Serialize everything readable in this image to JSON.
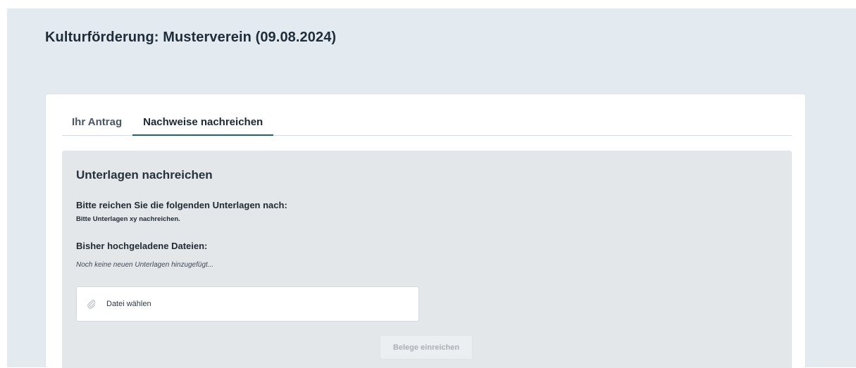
{
  "page": {
    "title": "Kulturförderung: Musterverein (09.08.2024)"
  },
  "tabs": [
    {
      "label": "Ihr Antrag",
      "active": false
    },
    {
      "label": "Nachweise nachreichen",
      "active": true
    }
  ],
  "panel": {
    "title": "Unterlagen nachreichen",
    "requested_heading": "Bitte reichen Sie die folgenden Unterlagen nach:",
    "requested_detail": "Bitte Unterlagen xy nachreichen.",
    "uploaded_heading": "Bisher hochgeladene Dateien:",
    "uploaded_empty": "Noch keine neuen Unterlagen hinzugefügt...",
    "file_picker": {
      "icon": "paperclip-icon",
      "label": "Datei wählen"
    },
    "submit_label": "Belege einreichen",
    "submit_disabled": true
  },
  "colors": {
    "background": "#e3eaf0",
    "panel": "#e4e7ea",
    "active_tab_underline": "#1f5f6e",
    "disabled_text": "#a8b0b7"
  }
}
